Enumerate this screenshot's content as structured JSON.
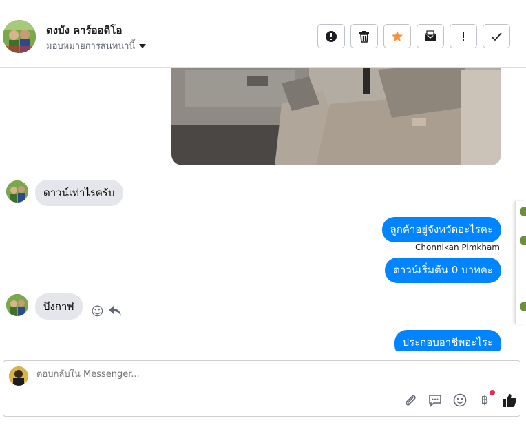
{
  "header": {
    "contact_name": "ดงบัง คาร์ออดิโอ",
    "assign_label": "มอบหมายการสนทนานี้"
  },
  "toolbar": {
    "buttons": [
      {
        "name": "spam-button",
        "icon": "alert-circle-icon"
      },
      {
        "name": "delete-button",
        "icon": "trash-icon"
      },
      {
        "name": "star-button",
        "icon": "star-icon",
        "color": "#f7923b"
      },
      {
        "name": "mark-unread-button",
        "icon": "envelope-icon"
      },
      {
        "name": "follow-up-button",
        "icon": "exclamation-icon"
      },
      {
        "name": "done-button",
        "icon": "check-icon"
      }
    ]
  },
  "messages": [
    {
      "direction": "incoming",
      "text": "ดาวน์เท่าไรครับ"
    },
    {
      "direction": "outgoing",
      "text": "ลูกค้าอยู่จังหวัดอะไรคะ"
    },
    {
      "direction": "outgoing",
      "sender": "Chonnikan Pimkham",
      "text": "ดาวน์เริ่มต้น 0 บาทคะ"
    },
    {
      "direction": "incoming",
      "text": "บึงกาฬ"
    },
    {
      "direction": "outgoing",
      "text": "ประกอบอาชีพอะไระ"
    }
  ],
  "composer": {
    "placeholder": "ตอบกลับใน Messenger..."
  },
  "colors": {
    "outgoing_bubble": "#0084ff",
    "incoming_bubble": "#e4e6eb",
    "like": "#1c1e21"
  }
}
